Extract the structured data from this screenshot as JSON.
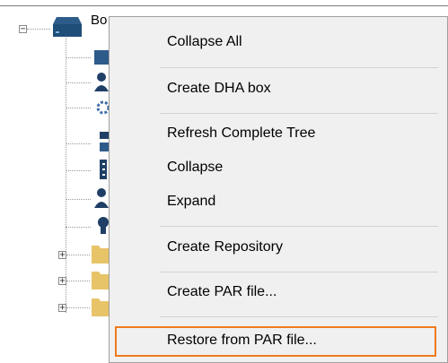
{
  "tree": {
    "root": {
      "label": "Bo",
      "icon": "server-box-icon",
      "expanded": true
    },
    "children": [
      {
        "icon": "box-icon"
      },
      {
        "icon": "user-icon"
      },
      {
        "icon": "gear-icon"
      },
      {
        "icon": "network-icon"
      },
      {
        "icon": "list-icon"
      },
      {
        "icon": "user-icon"
      },
      {
        "icon": "certificate-icon"
      },
      {
        "icon": "folder-icon",
        "expandable": true
      },
      {
        "icon": "folder-icon",
        "expandable": true
      },
      {
        "icon": "folder-icon",
        "expandable": true
      }
    ]
  },
  "context_menu": {
    "items": [
      {
        "label": "Collapse All"
      },
      {
        "label": "Create DHA box"
      },
      {
        "label": "Refresh Complete Tree"
      },
      {
        "label": "Collapse"
      },
      {
        "label": "Expand"
      },
      {
        "label": "Create Repository"
      },
      {
        "label": "Create PAR file..."
      },
      {
        "label": "Restore from PAR file...",
        "highlighted": true
      }
    ]
  },
  "colors": {
    "highlight_border": "#f07a1c",
    "menu_background": "#f0f0f0",
    "icon_blue": "#1f4e79",
    "folder_yellow": "#e8c468"
  }
}
